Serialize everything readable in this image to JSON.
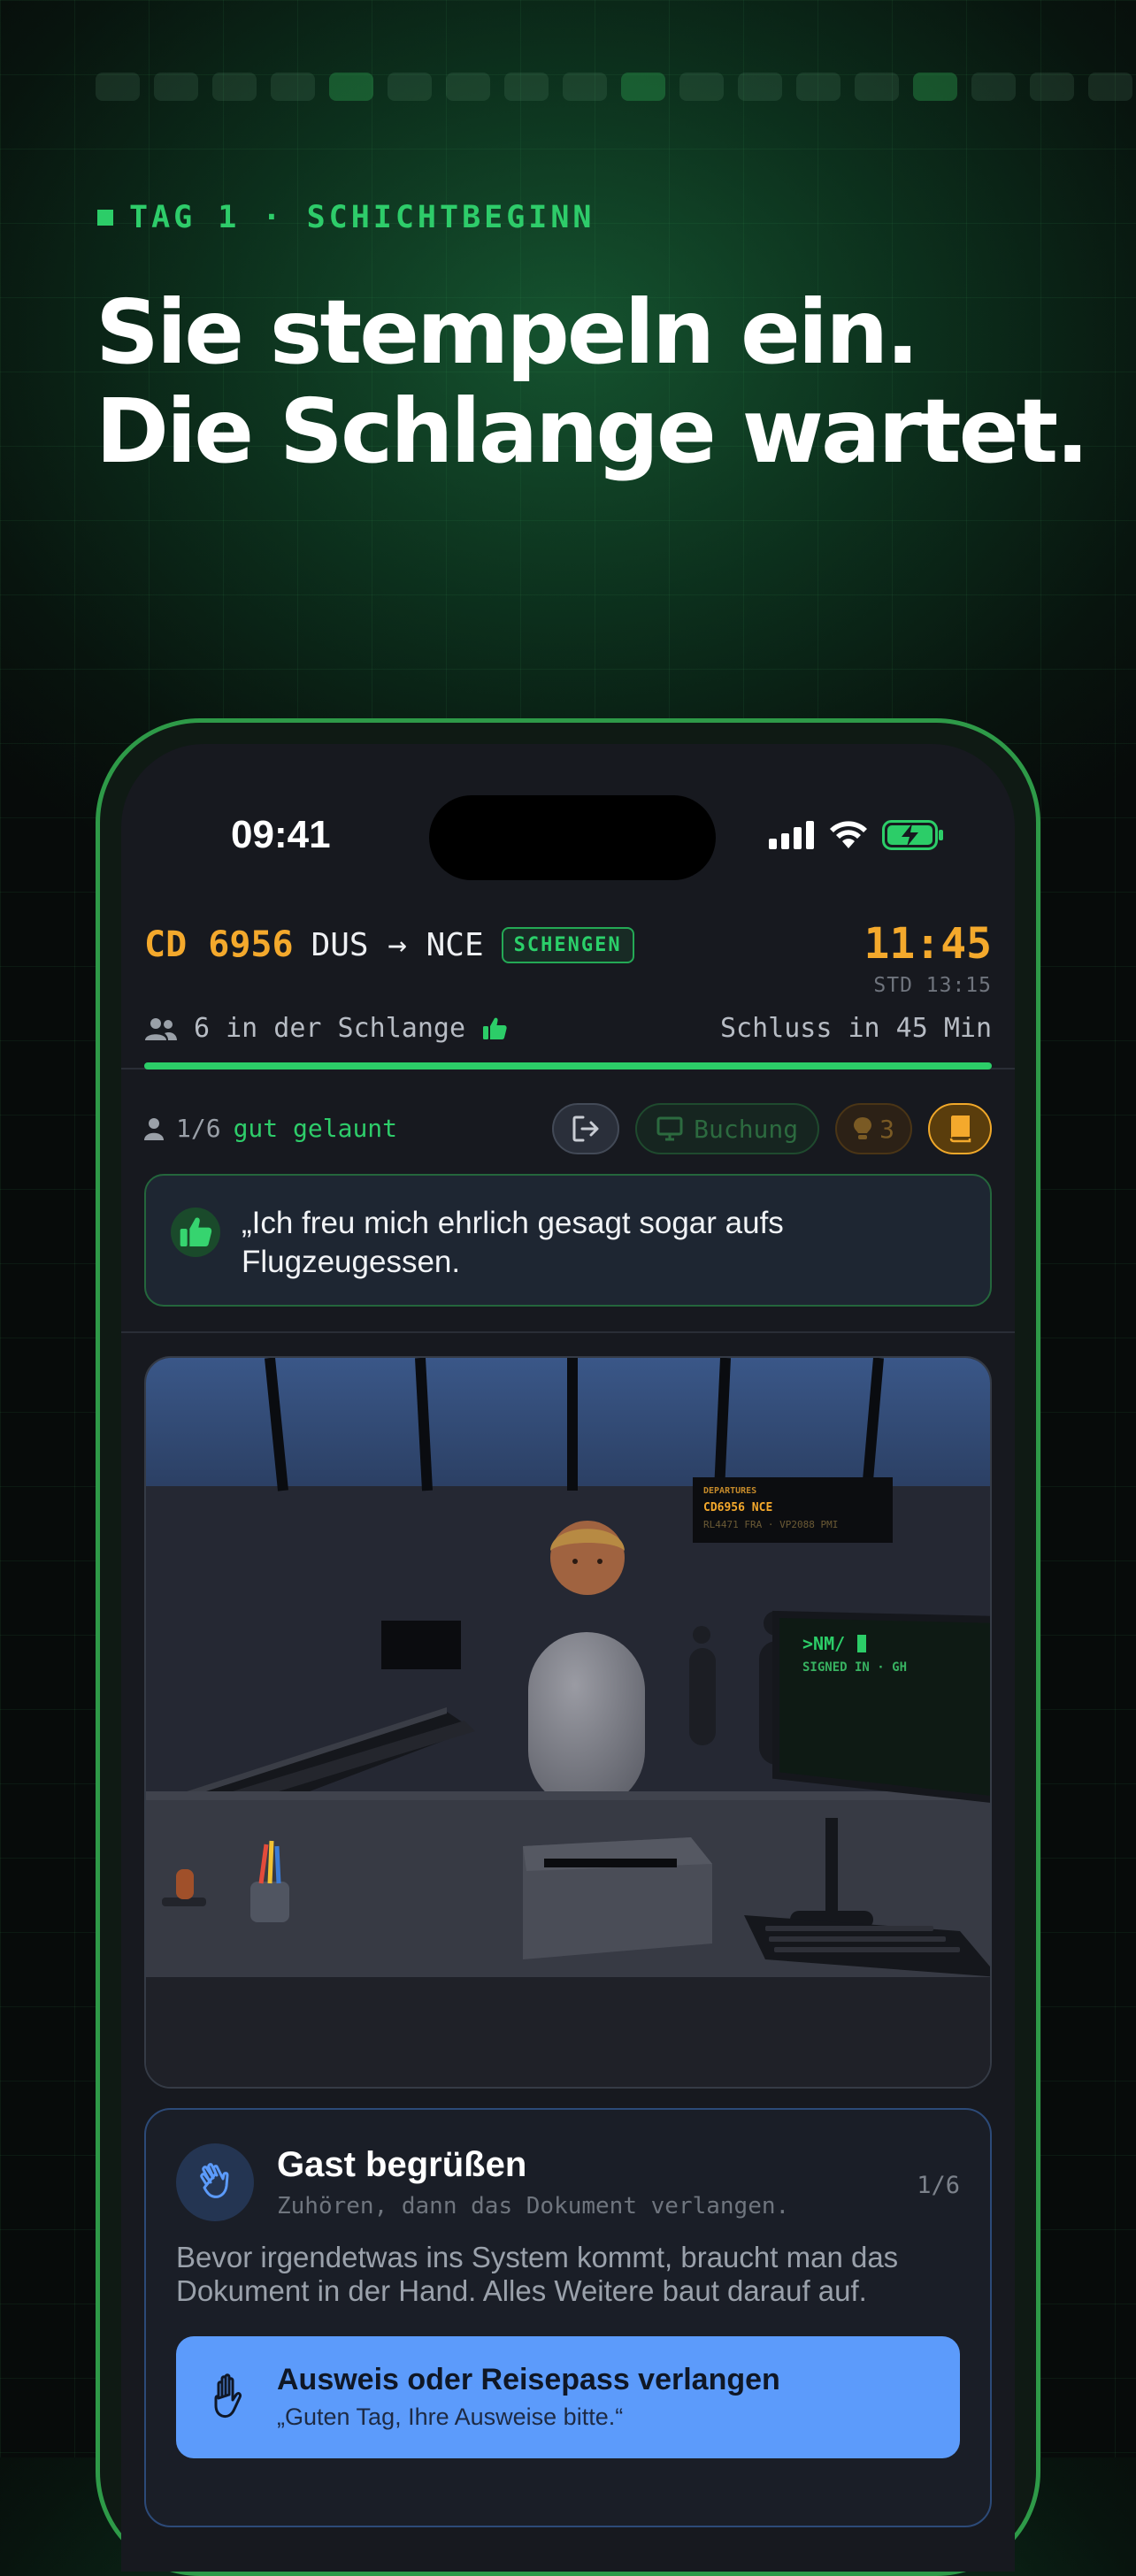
{
  "promo": {
    "eyebrow": "TAG 1 · SCHICHTBEGINN",
    "headline": [
      "Sie stempeln ein.",
      "Die Schlange wartet."
    ],
    "progress_segments": 18
  },
  "statusbar": {
    "time": "09:41"
  },
  "flight": {
    "code": "CD 6956",
    "route": "DUS → NCE",
    "zone_badge": "SCHENGEN",
    "clock": "11:45",
    "std": "STD 13:15",
    "queue_text": "6 in der Schlange",
    "closing_text": "Schluss in 45 Min",
    "time_remaining_fraction": 1.0
  },
  "passenger": {
    "counter": "1/6",
    "mood": "gut gelaunt",
    "quote": "„Ich freu mich ehrlich gesagt sogar aufs Flugzeugessen."
  },
  "tools": {
    "exit_icon": "exit-icon",
    "booking_label": "Buchung",
    "hints_count": "3",
    "manual_icon": "book-icon"
  },
  "scene": {
    "board_header": "DEPARTURES",
    "board_flight": "CD6956 NCE",
    "board_other": "RL4471 FRA · VP2088 PMI",
    "terminal_prompt": ">NM/",
    "terminal_status": "SIGNED IN · GH"
  },
  "task": {
    "title": "Gast begrüßen",
    "subtitle": "Zuhören, dann das Dokument verlangen.",
    "counter": "1/6",
    "body": "Bevor irgendetwas ins System kommt, braucht man das Dokument in der Hand. Alles Weitere baut darauf auf.",
    "action_title": "Ausweis oder Reisepass verlangen",
    "action_subtitle": "„Guten Tag, Ihre Ausweise bitte.“"
  },
  "colors": {
    "accent_green": "#2ccd68",
    "accent_amber": "#f4a92c",
    "action_blue": "#5c9bfb"
  }
}
